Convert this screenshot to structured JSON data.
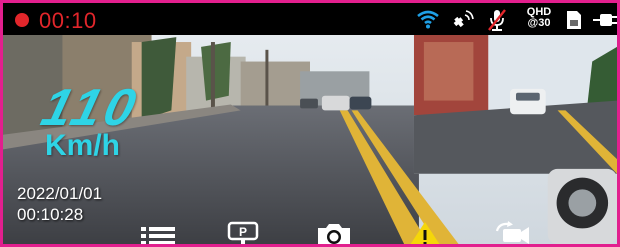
{
  "status_bar": {
    "rec_time": "00:10",
    "resolution_line1": "QHD",
    "resolution_line2": "@30"
  },
  "overlay": {
    "speed": "110",
    "speed_unit": "Km/h",
    "date": "2022/01/01",
    "time": "00:10:28"
  },
  "icons": {
    "top": [
      "recording-dot-icon",
      "wifi-icon",
      "gps-satellite-icon",
      "mic-muted-icon",
      "sd-card-icon",
      "power-plug-icon"
    ],
    "bottom": [
      "menu-icon",
      "parking-mode-icon",
      "camera-icon",
      "warning-icon",
      "switch-camera-icon"
    ]
  },
  "colors": {
    "frame_border": "#e21f8e",
    "recording": "#e2262b",
    "speed_text": "#2ed4e6",
    "wifi": "#1fa0e6",
    "warning": "#f5d60a"
  }
}
